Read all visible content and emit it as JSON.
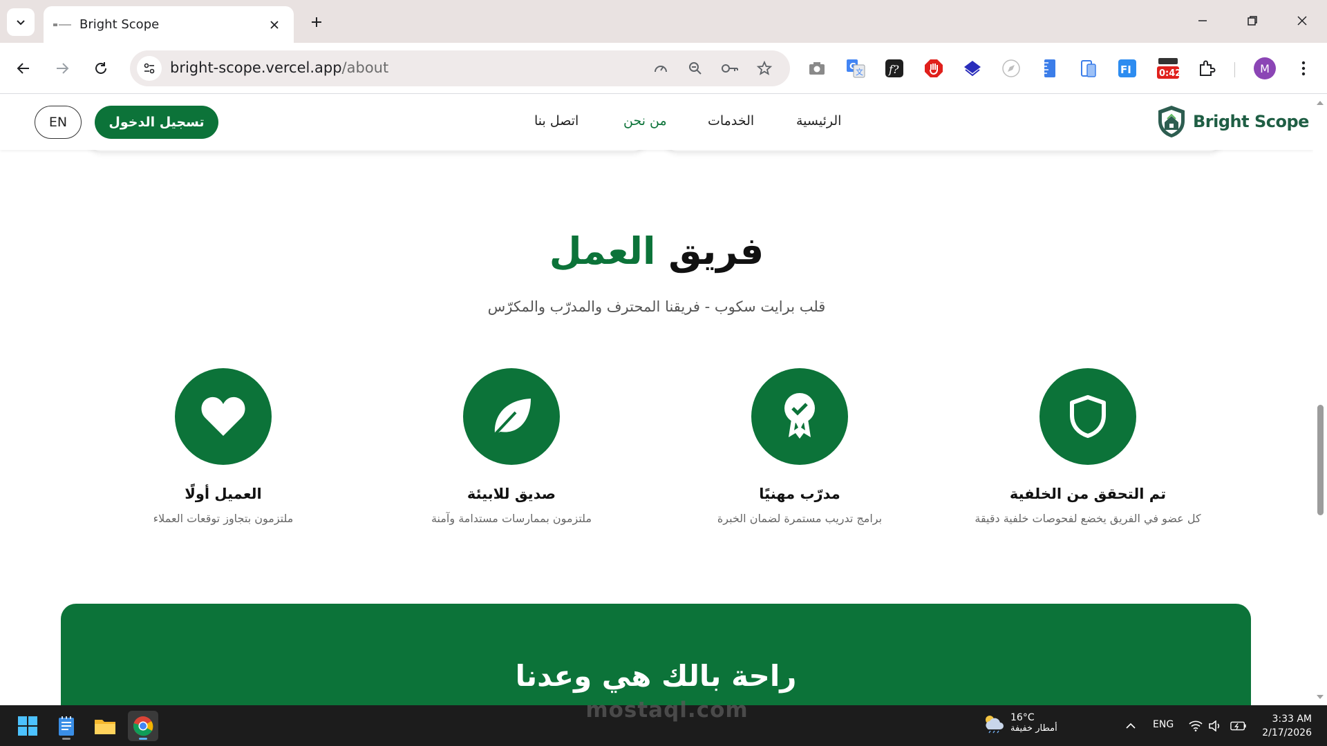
{
  "browser": {
    "tab_title": "Bright Scope",
    "url_host": "bright-scope.vercel.app",
    "url_path": "/about",
    "profile_initial": "M",
    "extension_badge": "0:42"
  },
  "site": {
    "brand": "Bright Scope",
    "nav": {
      "home": "الرئيسية",
      "services": "الخدمات",
      "about": "من نحن",
      "contact": "اتصل بنا"
    },
    "login_label": "تسجيل الدخول",
    "lang_label": "EN"
  },
  "team": {
    "title_main": "فريق",
    "title_accent": "العمل",
    "subtitle": "قلب برايت سكوب - فريقنا المحترف والمدرّب والمكرّس",
    "features": [
      {
        "icon": "shield-icon",
        "title": "تم التحقق من الخلفية",
        "desc": "كل عضو في الفريق يخضع لفحوصات خلفية دقيقة"
      },
      {
        "icon": "award-icon",
        "title": "مدرّب مهنيًا",
        "desc": "برامج تدريب مستمرة لضمان الخبرة"
      },
      {
        "icon": "leaf-icon",
        "title": "صديق للابيئة",
        "desc": "ملتزمون بممارسات مستدامة وآمنة"
      },
      {
        "icon": "heart-icon",
        "title": "العميل أولًا",
        "desc": "ملتزمون بتجاوز توقعات العملاء"
      }
    ]
  },
  "banner": {
    "title": "راحة بالك هي وعدنا"
  },
  "watermark": "mostaql.com",
  "taskbar": {
    "temperature": "16°C",
    "condition": "أمطار خفيفة",
    "language": "ENG",
    "time": "3:33 AM",
    "date": "2/17/2026"
  },
  "colors": {
    "brand_green": "#0c7339",
    "tab_strip": "#e9e2e1",
    "taskbar": "#1c1c1c"
  }
}
